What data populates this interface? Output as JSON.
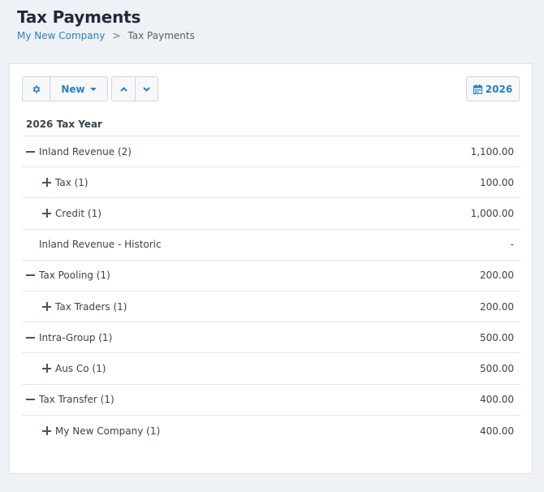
{
  "header": {
    "title": "Tax Payments",
    "breadcrumb": [
      {
        "label": "My New Company"
      },
      {
        "label": ">"
      },
      {
        "label": "Tax Payments"
      }
    ]
  },
  "toolbar": {
    "new_label": "New",
    "year_label": "2026",
    "icons": [
      "gear-icon",
      "chevron-up-icon",
      "chevron-down-icon",
      "calendar-icon"
    ]
  },
  "tree": {
    "heading": "2026 Tax Year",
    "rows": [
      {
        "label": "Inland Revenue (2)",
        "value": "1,100.00",
        "level": 0,
        "toggle": "minus"
      },
      {
        "label": "Tax (1)",
        "value": "100.00",
        "level": 1,
        "toggle": "plus"
      },
      {
        "label": "Credit (1)",
        "value": "1,000.00",
        "level": 1,
        "toggle": "plus"
      },
      {
        "label": "Inland Revenue - Historic",
        "value": "-",
        "level": 0,
        "toggle": "none"
      },
      {
        "label": "Tax Pooling (1)",
        "value": "200.00",
        "level": 0,
        "toggle": "minus"
      },
      {
        "label": "Tax Traders (1)",
        "value": "200.00",
        "level": 1,
        "toggle": "plus"
      },
      {
        "label": "Intra-Group (1)",
        "value": "500.00",
        "level": 0,
        "toggle": "minus"
      },
      {
        "label": "Aus Co (1)",
        "value": "500.00",
        "level": 1,
        "toggle": "plus"
      },
      {
        "label": "Tax Transfer (1)",
        "value": "400.00",
        "level": 0,
        "toggle": "minus"
      },
      {
        "label": "My New Company (1)",
        "value": "400.00",
        "level": 1,
        "toggle": "plus"
      }
    ]
  },
  "colors": {
    "accent": "#2a7fc1",
    "background": "#eef1f5",
    "panel": "#ffffff"
  }
}
